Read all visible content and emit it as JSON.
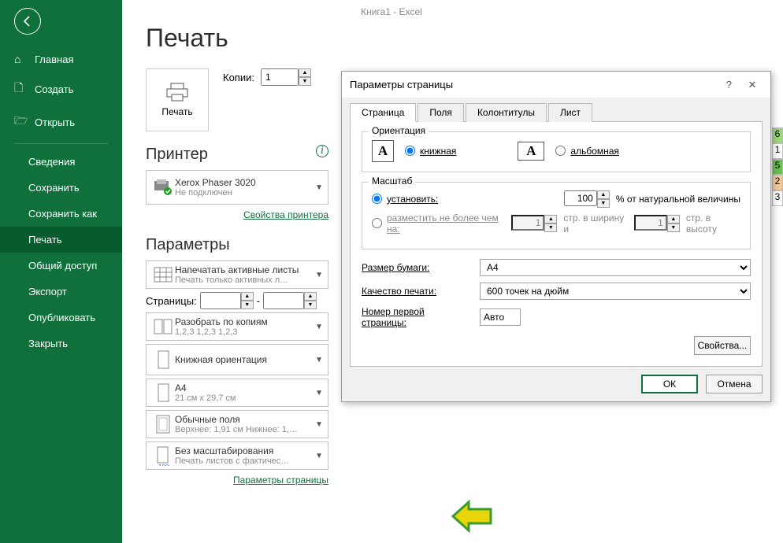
{
  "app_title": "Книга1  -  Excel",
  "page_title": "Печать",
  "sidebar": {
    "items": [
      {
        "label": "Главная",
        "icon": "⌂"
      },
      {
        "label": "Создать",
        "icon": "🗋"
      },
      {
        "label": "Открыть",
        "icon": "🗁"
      },
      {
        "label": "Сведения"
      },
      {
        "label": "Сохранить"
      },
      {
        "label": "Сохранить как"
      },
      {
        "label": "Печать"
      },
      {
        "label": "Общий доступ"
      },
      {
        "label": "Экспорт"
      },
      {
        "label": "Опубликовать"
      },
      {
        "label": "Закрыть"
      }
    ]
  },
  "print": {
    "print_btn": "Печать",
    "copies_label": "Копии:",
    "copies_value": "1"
  },
  "printer": {
    "section": "Принтер",
    "name": "Xerox Phaser 3020",
    "status": "Не подключен",
    "props_link": "Свойства принтера"
  },
  "params": {
    "section": "Параметры",
    "active": {
      "title": "Напечатать активные листы",
      "sub": "Печать только активных л…"
    },
    "pages_label": "Страницы:",
    "pages_sep": "-",
    "collate": {
      "title": "Разобрать по копиям",
      "sub": "1,2,3    1,2,3    1,2,3"
    },
    "orient": {
      "title": "Книжная ориентация"
    },
    "paper": {
      "title": "A4",
      "sub": "21 см x 29,7 см"
    },
    "margins": {
      "title": "Обычные поля",
      "sub": "Верхнее: 1,91 см Нижнее: 1,…"
    },
    "scale": {
      "title": "Без масштабирования",
      "sub": "Печать листов с фактичес…"
    },
    "page_setup_link": "Параметры страницы"
  },
  "dialog": {
    "title": "Параметры страницы",
    "tabs": [
      "Страница",
      "Поля",
      "Колонтитулы",
      "Лист"
    ],
    "orientation": {
      "group": "Ориентация",
      "portrait": "книжная",
      "landscape": "альбомная"
    },
    "scale": {
      "group": "Масштаб",
      "set_label": "установить:",
      "set_value": "100",
      "set_suffix": "% от натуральной величины",
      "fit_label": "разместить не более чем на:",
      "fit_w": "1",
      "fit_w_suffix": "стр. в ширину и",
      "fit_h": "1",
      "fit_h_suffix": "стр. в высоту"
    },
    "paper_label": "Размер бумаги:",
    "paper_value": "A4",
    "quality_label": "Качество печати:",
    "quality_value": "600 точек на дюйм",
    "first_page_label": "Номер первой страницы:",
    "first_page_value": "Авто",
    "props_btn": "Свойства...",
    "ok": "ОК",
    "cancel": "Отмена"
  },
  "sheet_cells": [
    "6",
    "1",
    "5",
    "2",
    "3"
  ]
}
